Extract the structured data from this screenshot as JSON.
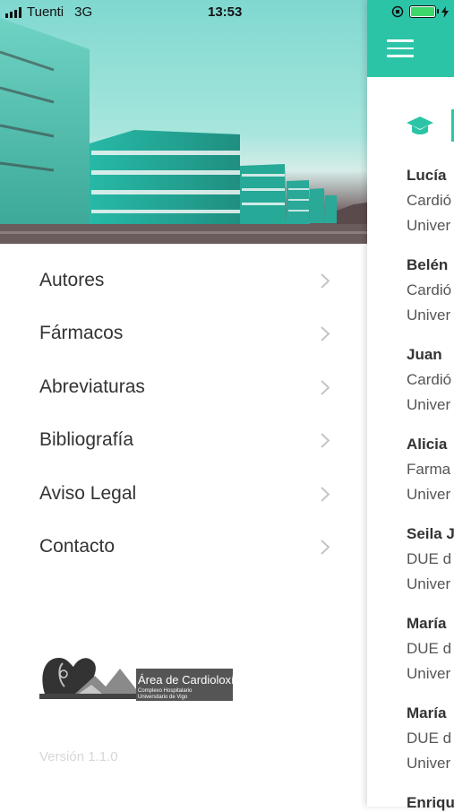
{
  "status_bar": {
    "carrier": "Tuenti",
    "network": "3G",
    "time": "13:53"
  },
  "menu": {
    "items": [
      {
        "label": "Autores"
      },
      {
        "label": "Fármacos"
      },
      {
        "label": "Abreviaturas"
      },
      {
        "label": "Bibliografía"
      },
      {
        "label": "Aviso Legal"
      },
      {
        "label": "Contacto"
      }
    ],
    "logo": {
      "title": "Área de Cardioloxía",
      "line1": "Complexo Hospitalario",
      "line2": "Universitario de Vigo"
    },
    "version": "Versión 1.1.0"
  },
  "panel": {
    "accent_color": "#2cc4a7",
    "entries": [
      {
        "name": "Lucía",
        "line1": "Cardió",
        "line2": "Univer"
      },
      {
        "name": "Belén",
        "line1": "Cardió",
        "line2": "Univer"
      },
      {
        "name": "Juan",
        "line1": "Cardió",
        "line2": "Univer"
      },
      {
        "name": "Alicia",
        "line1": "Farma",
        "line2": "Univer"
      },
      {
        "name": "Seila J",
        "line1": "DUE d",
        "line2": "Univer"
      },
      {
        "name": "María",
        "line1": "DUE d",
        "line2": "Univer"
      },
      {
        "name": "María",
        "line1": "DUE d",
        "line2": "Univer"
      },
      {
        "name": "Enriqu",
        "line1": "",
        "line2": ""
      }
    ]
  }
}
